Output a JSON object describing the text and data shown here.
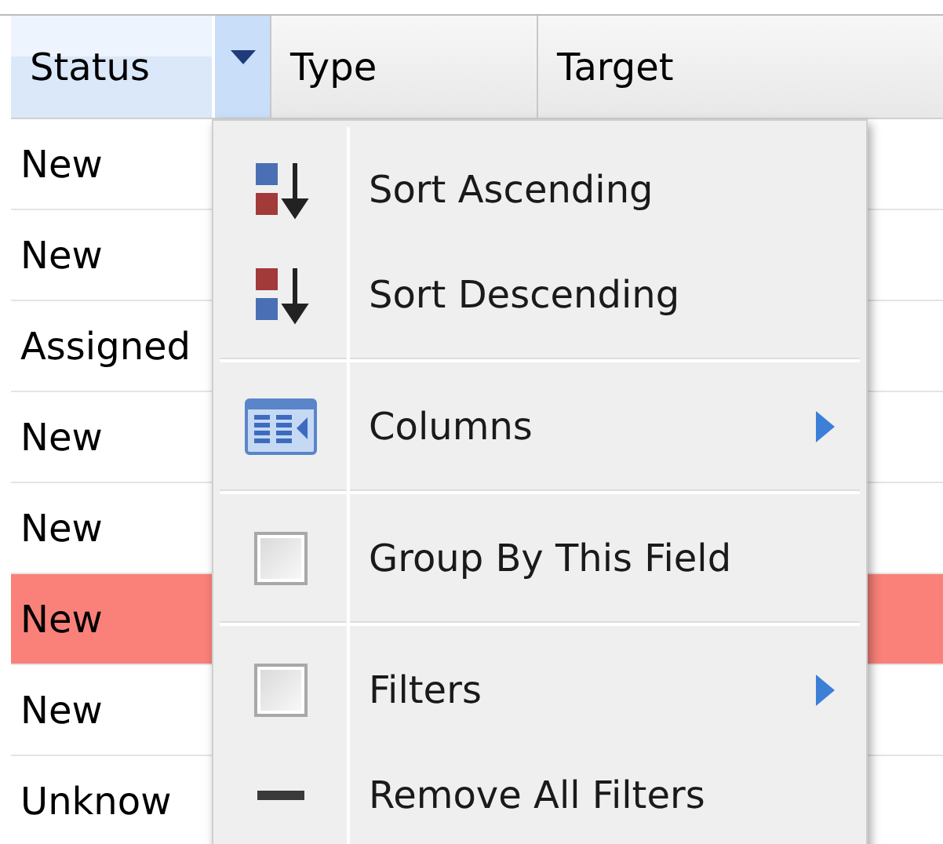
{
  "grid": {
    "columns": [
      {
        "label": "Status",
        "selected": true
      },
      {
        "label": "Type",
        "selected": false
      },
      {
        "label": "Target",
        "selected": false
      }
    ],
    "rows": [
      {
        "status": "New",
        "highlighted": false
      },
      {
        "status": "New",
        "highlighted": false
      },
      {
        "status": "Assigned",
        "highlighted": false
      },
      {
        "status": "New",
        "highlighted": false
      },
      {
        "status": "New",
        "highlighted": false
      },
      {
        "status": "New",
        "highlighted": true
      },
      {
        "status": "New",
        "highlighted": false
      },
      {
        "status": "Unknow",
        "highlighted": false
      }
    ]
  },
  "column_menu": {
    "groups": [
      [
        {
          "kind": "sort-ascending",
          "label": "Sort Ascending",
          "submenu": false
        },
        {
          "kind": "sort-descending",
          "label": "Sort Descending",
          "submenu": false
        }
      ],
      [
        {
          "kind": "columns",
          "label": "Columns",
          "submenu": true
        }
      ],
      [
        {
          "kind": "checkbox",
          "label": "Group By This Field",
          "checked": false,
          "submenu": false
        }
      ],
      [
        {
          "kind": "checkbox",
          "label": "Filters",
          "checked": false,
          "submenu": true
        },
        {
          "kind": "remove",
          "label": "Remove All Filters",
          "submenu": false
        }
      ]
    ]
  }
}
